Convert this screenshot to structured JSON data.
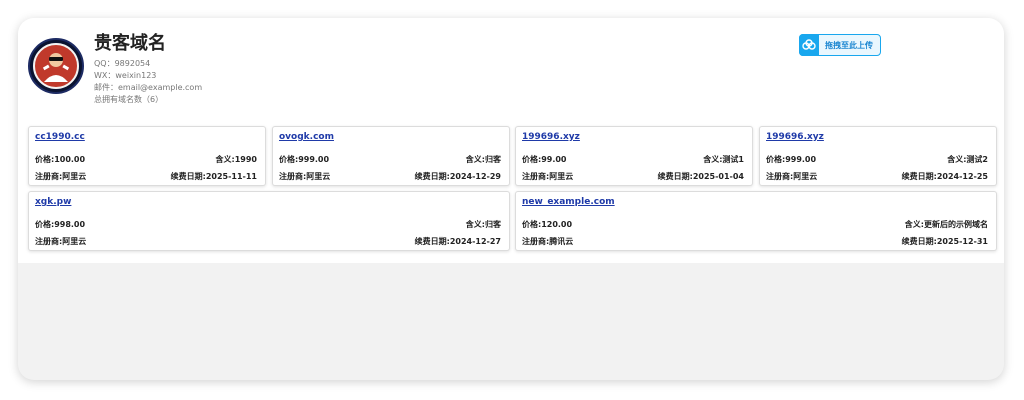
{
  "profile": {
    "title": "贵客域名",
    "qq": "QQ：9892054",
    "wx": "WX：weixin123",
    "email": "邮件：email@example.com",
    "count": "总拥有域名数（6）"
  },
  "upload": {
    "label": "拖拽至此上传",
    "icon": "cloud-upload-icon"
  },
  "colors": {
    "accent": "#19a7ee",
    "link": "#1f3aa8"
  },
  "domains": [
    {
      "name": "cc1990.cc",
      "price": "价格:100.00",
      "meaning": "含义:1990",
      "registrar": "注册商:阿里云",
      "renewal": "续费日期:2025-11-11"
    },
    {
      "name": "ovogk.com",
      "price": "价格:999.00",
      "meaning": "含义:归客",
      "registrar": "注册商:阿里云",
      "renewal": "续费日期:2024-12-29"
    },
    {
      "name": "199696.xyz",
      "price": "价格:99.00",
      "meaning": "含义:测试1",
      "registrar": "注册商:阿里云",
      "renewal": "续费日期:2025-01-04"
    },
    {
      "name": "199696.xyz",
      "price": "价格:999.00",
      "meaning": "含义:测试2",
      "registrar": "注册商:阿里云",
      "renewal": "续费日期:2024-12-25"
    },
    {
      "name": "xgk.pw",
      "price": "价格:998.00",
      "meaning": "含义:归客",
      "registrar": "注册商:阿里云",
      "renewal": "续费日期:2024-12-27"
    },
    {
      "name": "new_example.com",
      "price": "价格:120.00",
      "meaning": "含义:更新后的示例域名",
      "registrar": "注册商:腾讯云",
      "renewal": "续费日期:2025-12-31"
    }
  ]
}
